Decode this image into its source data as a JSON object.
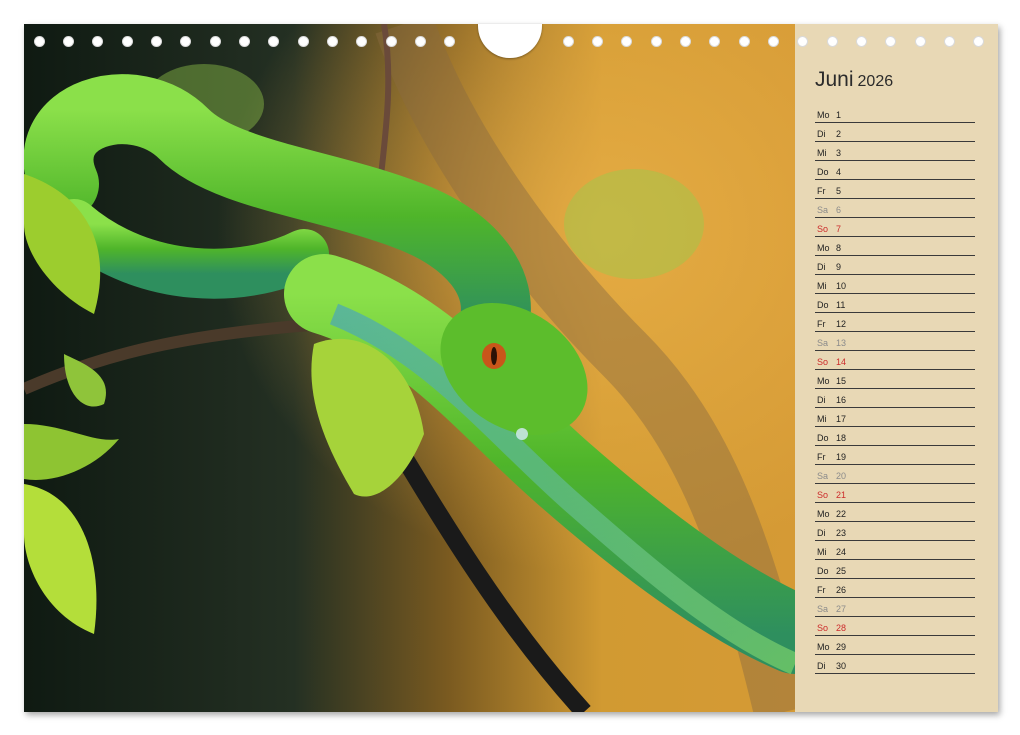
{
  "calendar": {
    "month": "Juni",
    "year": "2026",
    "days": [
      {
        "wd": "Mo",
        "d": "1",
        "type": "weekday"
      },
      {
        "wd": "Di",
        "d": "2",
        "type": "weekday"
      },
      {
        "wd": "Mi",
        "d": "3",
        "type": "weekday"
      },
      {
        "wd": "Do",
        "d": "4",
        "type": "weekday"
      },
      {
        "wd": "Fr",
        "d": "5",
        "type": "weekday"
      },
      {
        "wd": "Sa",
        "d": "6",
        "type": "sat"
      },
      {
        "wd": "So",
        "d": "7",
        "type": "sun"
      },
      {
        "wd": "Mo",
        "d": "8",
        "type": "weekday"
      },
      {
        "wd": "Di",
        "d": "9",
        "type": "weekday"
      },
      {
        "wd": "Mi",
        "d": "10",
        "type": "weekday"
      },
      {
        "wd": "Do",
        "d": "11",
        "type": "weekday"
      },
      {
        "wd": "Fr",
        "d": "12",
        "type": "weekday"
      },
      {
        "wd": "Sa",
        "d": "13",
        "type": "sat"
      },
      {
        "wd": "So",
        "d": "14",
        "type": "sun"
      },
      {
        "wd": "Mo",
        "d": "15",
        "type": "weekday"
      },
      {
        "wd": "Di",
        "d": "16",
        "type": "weekday"
      },
      {
        "wd": "Mi",
        "d": "17",
        "type": "weekday"
      },
      {
        "wd": "Do",
        "d": "18",
        "type": "weekday"
      },
      {
        "wd": "Fr",
        "d": "19",
        "type": "weekday"
      },
      {
        "wd": "Sa",
        "d": "20",
        "type": "sat"
      },
      {
        "wd": "So",
        "d": "21",
        "type": "sun"
      },
      {
        "wd": "Mo",
        "d": "22",
        "type": "weekday"
      },
      {
        "wd": "Di",
        "d": "23",
        "type": "weekday"
      },
      {
        "wd": "Mi",
        "d": "24",
        "type": "weekday"
      },
      {
        "wd": "Do",
        "d": "25",
        "type": "weekday"
      },
      {
        "wd": "Fr",
        "d": "26",
        "type": "weekday"
      },
      {
        "wd": "Sa",
        "d": "27",
        "type": "sat"
      },
      {
        "wd": "So",
        "d": "28",
        "type": "sun"
      },
      {
        "wd": "Mo",
        "d": "29",
        "type": "weekday"
      },
      {
        "wd": "Di",
        "d": "30",
        "type": "weekday"
      }
    ]
  },
  "colors": {
    "panel": "#e8d8b5",
    "sunday": "#cc2b2b",
    "saturday": "#8b8b8b",
    "snake_green": "#5fc428"
  },
  "photo": {
    "subject": "snake-photo"
  }
}
